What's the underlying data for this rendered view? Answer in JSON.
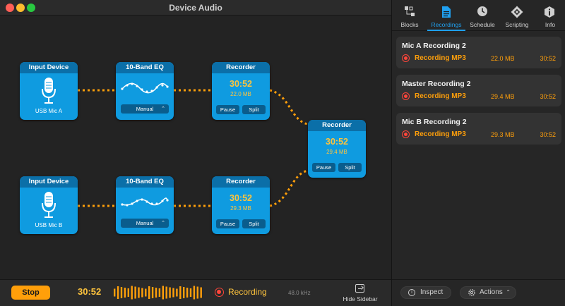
{
  "window": {
    "title": "Device Audio"
  },
  "blocks": {
    "input_a": {
      "header": "Input Device",
      "device": "USB Mic A"
    },
    "eq_a": {
      "header": "10-Band EQ",
      "preset": "Manual"
    },
    "recorder_a": {
      "header": "Recorder",
      "time": "30:52",
      "size": "22.0 MB",
      "pause": "Pause",
      "split": "Split"
    },
    "input_b": {
      "header": "Input Device",
      "device": "USB Mic B"
    },
    "eq_b": {
      "header": "10-Band EQ",
      "preset": "Manual"
    },
    "recorder_b": {
      "header": "Recorder",
      "time": "30:52",
      "size": "29.3 MB",
      "pause": "Pause",
      "split": "Split"
    },
    "recorder_master": {
      "header": "Recorder",
      "time": "30:52",
      "size": "29.4 MB",
      "pause": "Pause",
      "split": "Split"
    }
  },
  "bottom_bar": {
    "stop_label": "Stop",
    "elapsed": "30:52",
    "status": "Recording",
    "sample_rate": "48.0 kHz",
    "hide_sidebar": "Hide Sidebar"
  },
  "sidebar": {
    "tabs": [
      {
        "label": "Blocks",
        "icon": "blocks-icon"
      },
      {
        "label": "Recordings",
        "icon": "recordings-icon",
        "active": true
      },
      {
        "label": "Schedule",
        "icon": "clock-icon"
      },
      {
        "label": "Scripting",
        "icon": "scripting-icon"
      },
      {
        "label": "Info",
        "icon": "info-icon"
      }
    ],
    "recordings": [
      {
        "title": "Mic A Recording 2",
        "format": "Recording MP3",
        "size": "22.0 MB",
        "duration": "30:52"
      },
      {
        "title": "Master Recording 2",
        "format": "Recording MP3",
        "size": "29.4 MB",
        "duration": "30:52"
      },
      {
        "title": "Mic B Recording 2",
        "format": "Recording MP3",
        "size": "29.3 MB",
        "duration": "30:52"
      }
    ],
    "footer": {
      "inspect": "Inspect",
      "actions": "Actions"
    }
  },
  "colors": {
    "block": "#0f9be0",
    "block_header": "#0b6fa8",
    "accent_orange": "#ff9f0a",
    "time_yellow": "#ffc43d",
    "record_red": "#ff453a",
    "tab_active": "#1fa0f0"
  }
}
